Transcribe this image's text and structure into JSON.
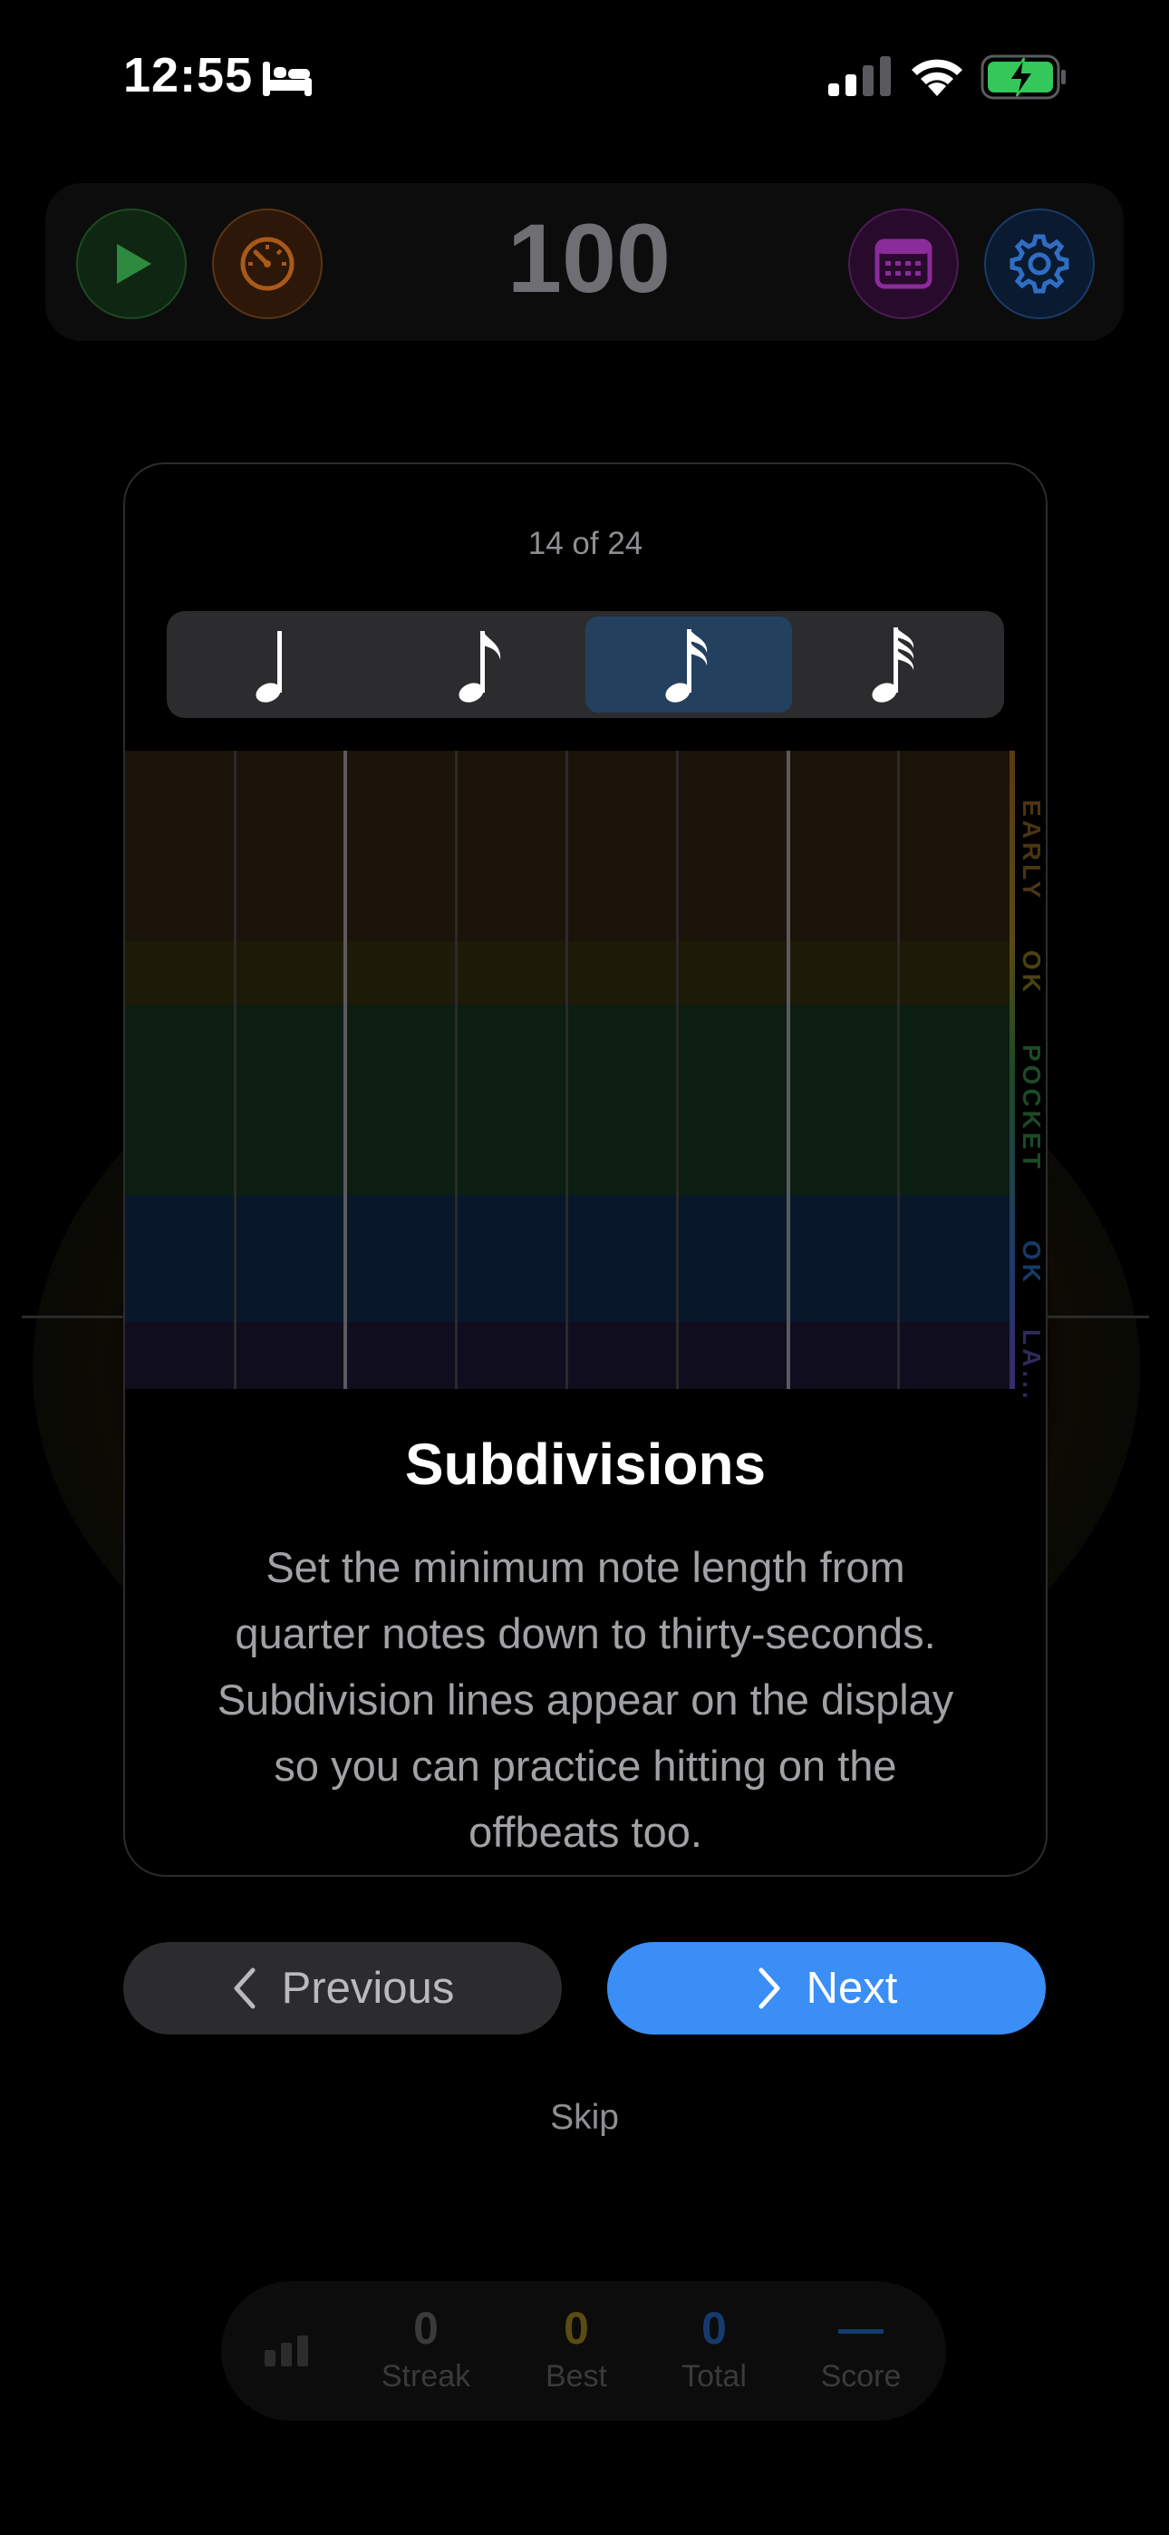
{
  "status_bar": {
    "time": "12:55"
  },
  "toolbar": {
    "bpm": "100"
  },
  "tutorial": {
    "step_counter": "14 of 24",
    "subdivisions": [
      {
        "name": "quarter-note",
        "selected": false
      },
      {
        "name": "eighth-note",
        "selected": false
      },
      {
        "name": "sixteenth-note",
        "selected": true
      },
      {
        "name": "thirty-second-note",
        "selected": false
      }
    ],
    "zones": {
      "early": "EARLY",
      "ok_top": "OK",
      "pocket": "POCKET",
      "ok_bottom": "OK",
      "late": "LA..."
    },
    "title": "Subdivisions",
    "description": "Set the minimum note length from quarter notes down to thirty-seconds. Subdivision lines appear on the display so you can practice hitting on the offbeats too.",
    "previous_label": "Previous",
    "next_label": "Next",
    "skip_label": "Skip"
  },
  "stats": [
    {
      "value": "0",
      "label": "Streak",
      "color": "#3a3a3c"
    },
    {
      "value": "0",
      "label": "Best",
      "color": "#5c4b12"
    },
    {
      "value": "0",
      "label": "Total",
      "color": "#163a6e"
    },
    {
      "value": "—",
      "label": "Score",
      "color": "#163a6e"
    }
  ],
  "colors": {
    "accent": "#3a8ef6",
    "selected_segment": "#24405f",
    "early_band": "#1a1309",
    "ok_band": "#1d1a07",
    "pocket_band": "#0c1d12",
    "ok_blue_band": "#08172a",
    "late_band": "#100d1e"
  }
}
